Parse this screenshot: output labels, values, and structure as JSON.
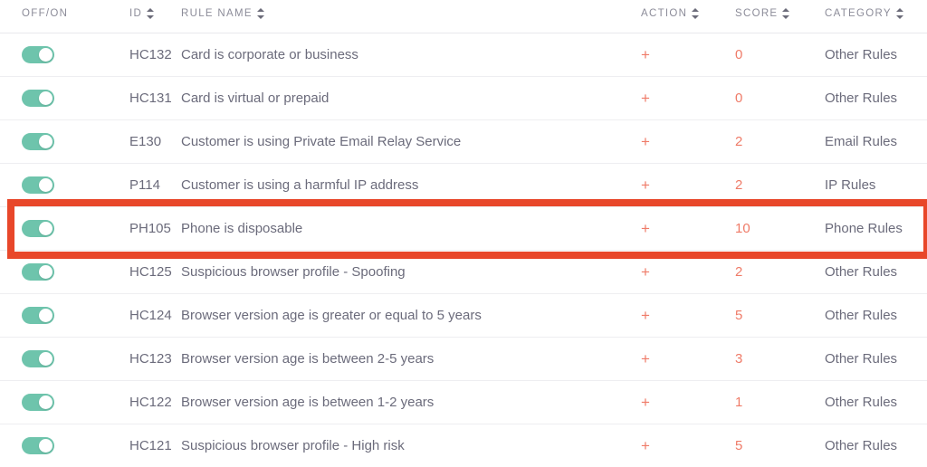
{
  "table": {
    "columns": [
      {
        "key": "offon",
        "label": "OFF/ON",
        "sortable": false
      },
      {
        "key": "id",
        "label": "ID",
        "sortable": true
      },
      {
        "key": "rule",
        "label": "RULE NAME",
        "sortable": true
      },
      {
        "key": "action",
        "label": "ACTION",
        "sortable": true
      },
      {
        "key": "score",
        "label": "SCORE",
        "sortable": true
      },
      {
        "key": "category",
        "label": "CATEGORY",
        "sortable": true
      }
    ],
    "rows": [
      {
        "toggle": "on",
        "id": "HC132",
        "rule": "Card is corporate or business",
        "action": "+",
        "score": "0",
        "category": "Other Rules",
        "highlighted": false
      },
      {
        "toggle": "on",
        "id": "HC131",
        "rule": "Card is virtual or prepaid",
        "action": "+",
        "score": "0",
        "category": "Other Rules",
        "highlighted": false
      },
      {
        "toggle": "on",
        "id": "E130",
        "rule": "Customer is using Private Email Relay Service",
        "action": "+",
        "score": "2",
        "category": "Email Rules",
        "highlighted": false
      },
      {
        "toggle": "on",
        "id": "P114",
        "rule": "Customer is using a harmful IP address",
        "action": "+",
        "score": "2",
        "category": "IP Rules",
        "highlighted": false
      },
      {
        "toggle": "on",
        "id": "PH105",
        "rule": "Phone is disposable",
        "action": "+",
        "score": "10",
        "category": "Phone Rules",
        "highlighted": true
      },
      {
        "toggle": "on",
        "id": "HC125",
        "rule": "Suspicious browser profile - Spoofing",
        "action": "+",
        "score": "2",
        "category": "Other Rules",
        "highlighted": false
      },
      {
        "toggle": "on",
        "id": "HC124",
        "rule": "Browser version age is greater or equal to 5 years",
        "action": "+",
        "score": "5",
        "category": "Other Rules",
        "highlighted": false
      },
      {
        "toggle": "on",
        "id": "HC123",
        "rule": "Browser version age is between 2-5 years",
        "action": "+",
        "score": "3",
        "category": "Other Rules",
        "highlighted": false
      },
      {
        "toggle": "on",
        "id": "HC122",
        "rule": "Browser version age is between 1-2 years",
        "action": "+",
        "score": "1",
        "category": "Other Rules",
        "highlighted": false
      },
      {
        "toggle": "on",
        "id": "HC121",
        "rule": "Suspicious browser profile - High risk",
        "action": "+",
        "score": "5",
        "category": "Other Rules",
        "highlighted": false
      }
    ]
  },
  "icons": {
    "sort": "sort-arrows-icon",
    "toggle": "toggle-switch-icon"
  },
  "colors": {
    "toggle_on": "#6ec4ac",
    "accent_red": "#ef7b68",
    "highlight_border": "#e8472a",
    "text": "#6b6b7b",
    "header_text": "#8c8c99",
    "row_divider": "#eeeef1"
  }
}
